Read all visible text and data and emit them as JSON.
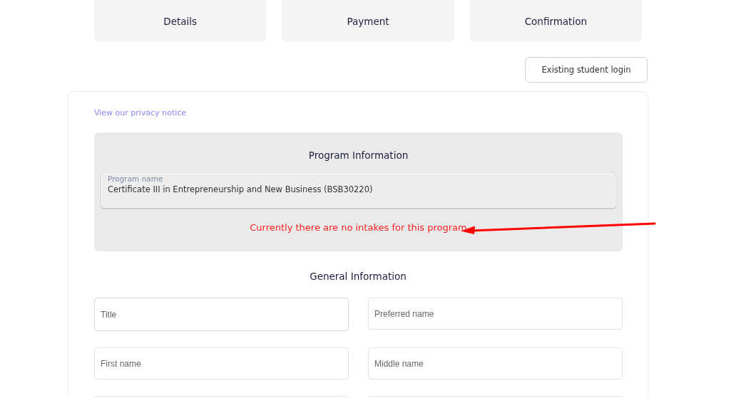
{
  "steps": [
    {
      "label": "Details"
    },
    {
      "label": "Payment"
    },
    {
      "label": "Confirmation"
    }
  ],
  "login_button": "Existing student login",
  "privacy_link": "View our privacy notice",
  "program_information": {
    "heading": "Program Information",
    "field_label": "Program name",
    "field_value": "Certificate III in Entrepreneurship and New Business (BSB30220)",
    "error": "Currently there are no intakes for this program"
  },
  "general_information": {
    "heading": "General Information",
    "fields": [
      {
        "placeholder": "Title"
      },
      {
        "placeholder": "Preferred name"
      },
      {
        "placeholder": "First name"
      },
      {
        "placeholder": "Middle name"
      }
    ]
  }
}
